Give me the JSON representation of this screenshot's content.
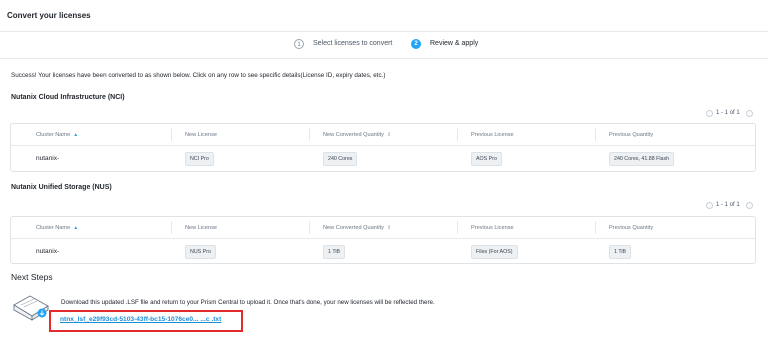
{
  "header": {
    "title": "Convert your licenses"
  },
  "steps": [
    {
      "number": "1",
      "label": "Select licenses to convert"
    },
    {
      "number": "2",
      "label": "Review & apply"
    }
  ],
  "success_message": "Success! Your licenses have been converted to as shown below. Click on any row to see specific details(License ID, expiry dates, etc.)",
  "sections": [
    {
      "title": "Nutanix Cloud Infrastructure (NCI)",
      "pager": "1 - 1 of 1",
      "columns": [
        "Cluster Name",
        "New License",
        "New Converted Quantity",
        "Previous License",
        "Previous Quantity"
      ],
      "row": {
        "cluster": "nutanix-",
        "new_license": "NCI Pro",
        "new_quantity": "240 Cores",
        "prev_license": "AOS Pro",
        "prev_quantity": "240 Cores, 41.88 Flash"
      }
    },
    {
      "title": "Nutanix Unified Storage (NUS)",
      "pager": "1 - 1 of 1",
      "columns": [
        "Cluster Name",
        "New License",
        "New Converted Quantity",
        "Previous License",
        "Previous Quantity"
      ],
      "row": {
        "cluster": "nutanix-",
        "new_license": "NUS Pro",
        "new_quantity": "1 TiB",
        "prev_license": "Files (For AOS)",
        "prev_quantity": "1 TiB"
      }
    }
  ],
  "next_steps": {
    "title": "Next Steps",
    "description": "Download this updated .LSF file and return to your Prism Central to upload it. Once that's done, your new licenses will be reflected there.",
    "file_link": "ntnx_lsf_e29f93cd-5103-43ff-bc15-1076ce0... ...c .txt"
  },
  "colors": {
    "accent": "#22a5f7",
    "link": "#1a8ed8",
    "highlight": "#e32b2b"
  },
  "icons": {
    "license_file": "license-file-icon",
    "sort": "sort-arrow-icon"
  }
}
